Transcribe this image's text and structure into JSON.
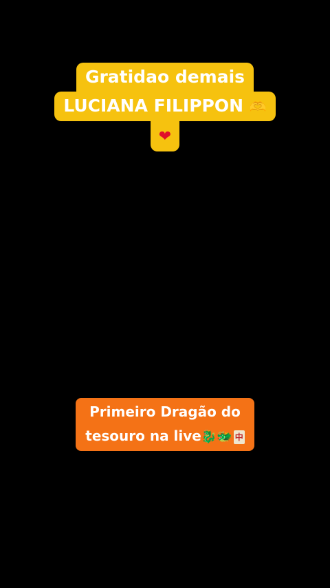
{
  "top_caption": {
    "line1": "Gratidao demais",
    "line2_text": "LUCIANA FILIPPON ",
    "line2_emoji": "🫶",
    "line3_emoji": "❤",
    "background": "#f6c20f",
    "text_color": "#ffffff"
  },
  "bottom_caption": {
    "line1": "Primeiro Dragão do",
    "line2_text": "tesouro na live",
    "emoji_dragon": "🐉",
    "emoji_dragon_face": "🐲",
    "emoji_mahjong": "中",
    "background": "#f47216",
    "text_color": "#ffffff"
  }
}
